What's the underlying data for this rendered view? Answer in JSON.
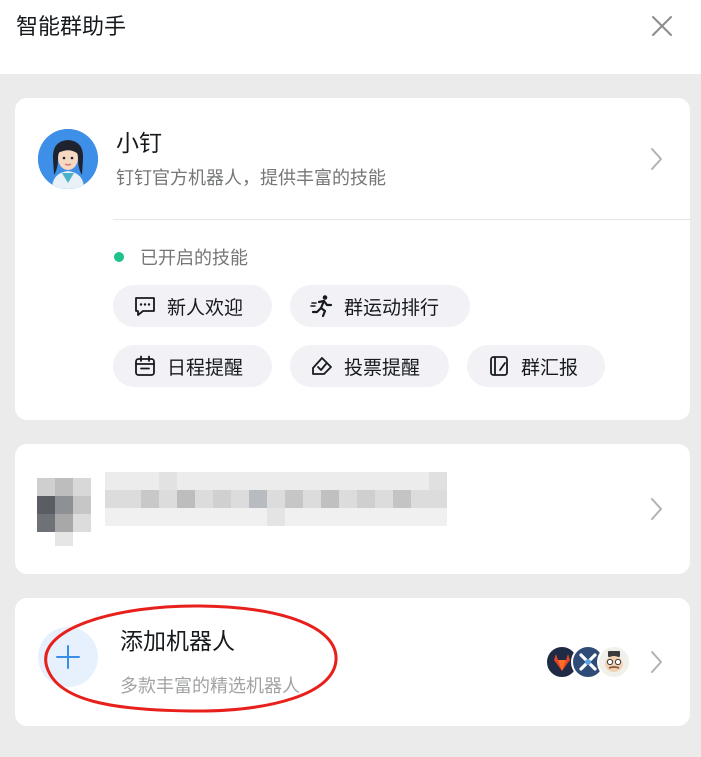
{
  "header": {
    "title": "智能群助手"
  },
  "bot": {
    "name": "小钉",
    "description": "钉钉官方机器人，提供丰富的技能",
    "skills_label": "已开启的技能",
    "skills": [
      {
        "label": "新人欢迎",
        "icon": "chat-bubble-icon"
      },
      {
        "label": "群运动排行",
        "icon": "running-person-icon"
      },
      {
        "label": "日程提醒",
        "icon": "calendar-icon"
      },
      {
        "label": "投票提醒",
        "icon": "vote-check-icon"
      },
      {
        "label": "群汇报",
        "icon": "report-icon"
      }
    ]
  },
  "add_robot": {
    "title": "添加机器人",
    "description": "多款丰富的精选机器人"
  },
  "colors": {
    "accent_green": "#1ec28b",
    "plus_blue": "#3a8ee6",
    "annotation_red": "#e8201c"
  }
}
